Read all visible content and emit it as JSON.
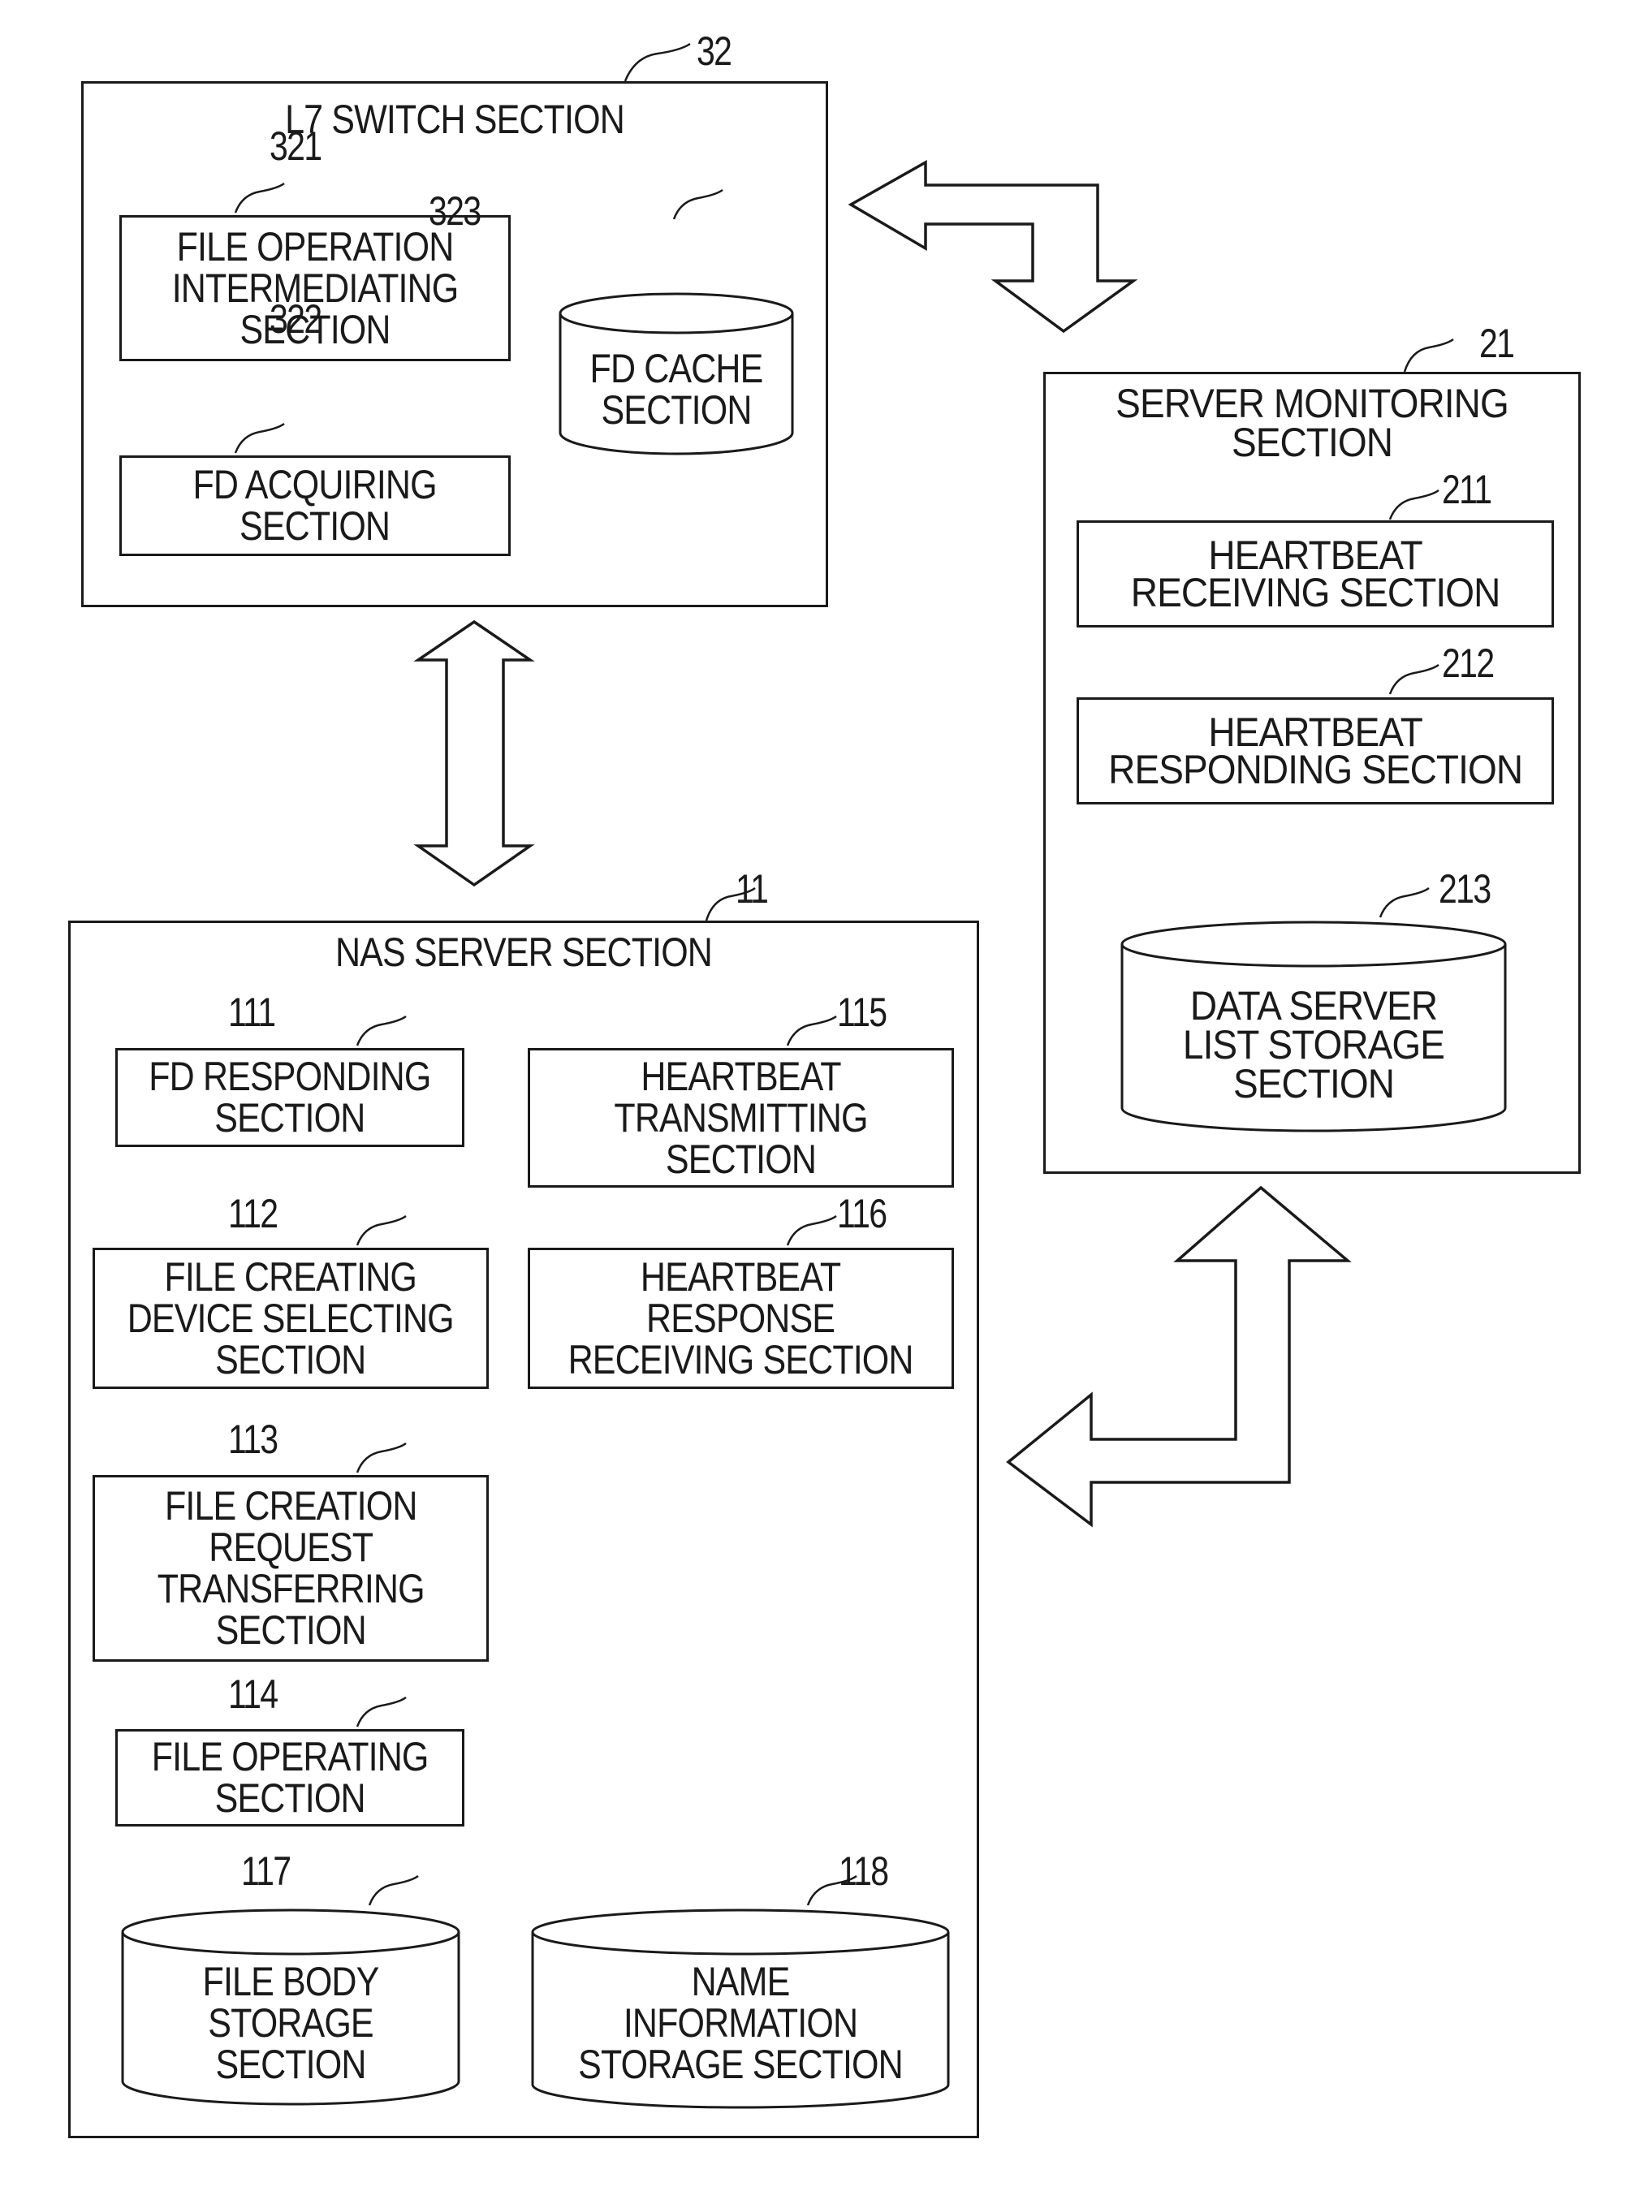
{
  "blocks": {
    "l7_switch": {
      "title": "L7 SWITCH SECTION",
      "ref": "32",
      "file_operation_intermediating": {
        "label": "FILE OPERATION\nINTERMEDIATING\nSECTION",
        "ref": "321"
      },
      "fd_acquiring": {
        "label": "FD ACQUIRING\nSECTION",
        "ref": "322"
      },
      "fd_cache": {
        "label": "FD CACHE\nSECTION",
        "ref": "323"
      }
    },
    "server_monitoring": {
      "title": "SERVER MONITORING\nSECTION",
      "ref": "21",
      "heartbeat_receiving": {
        "label": "HEARTBEAT\nRECEIVING SECTION",
        "ref": "211"
      },
      "heartbeat_responding": {
        "label": "HEARTBEAT\nRESPONDING SECTION",
        "ref": "212"
      },
      "data_server_list_storage": {
        "label": "DATA SERVER\nLIST STORAGE\nSECTION",
        "ref": "213"
      }
    },
    "nas_server": {
      "title": "NAS SERVER SECTION",
      "ref": "11",
      "fd_responding": {
        "label": "FD RESPONDING\nSECTION",
        "ref": "111"
      },
      "file_creating_device_selecting": {
        "label": "FILE CREATING\nDEVICE SELECTING\nSECTION",
        "ref": "112"
      },
      "file_creation_request_transferring": {
        "label": "FILE CREATION\nREQUEST\nTRANSFERRING\nSECTION",
        "ref": "113"
      },
      "file_operating": {
        "label": "FILE OPERATING\nSECTION",
        "ref": "114"
      },
      "heartbeat_transmitting": {
        "label": "HEARTBEAT\nTRANSMITTING\nSECTION",
        "ref": "115"
      },
      "heartbeat_response_receiving": {
        "label": "HEARTBEAT\nRESPONSE\nRECEIVING SECTION",
        "ref": "116"
      },
      "file_body_storage": {
        "label": "FILE BODY\nSTORAGE\nSECTION",
        "ref": "117"
      },
      "name_information_storage": {
        "label": "NAME\nINFORMATION\nSTORAGE SECTION",
        "ref": "118"
      }
    }
  },
  "connections": [
    {
      "from": "L7 SWITCH SECTION",
      "to": "SERVER MONITORING SECTION",
      "type": "bidirectional-elbow"
    },
    {
      "from": "L7 SWITCH SECTION",
      "to": "NAS SERVER SECTION",
      "type": "bidirectional-vertical"
    },
    {
      "from": "NAS SERVER SECTION",
      "to": "SERVER MONITORING SECTION",
      "type": "bidirectional-elbow"
    }
  ]
}
